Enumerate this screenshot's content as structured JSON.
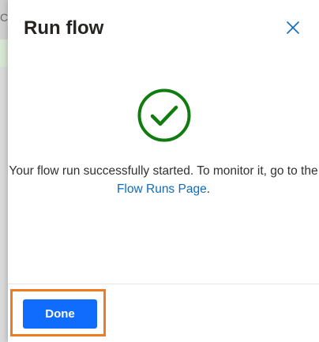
{
  "backdrop": {
    "partial_char": "C"
  },
  "panel": {
    "title": "Run flow",
    "close_icon": "close-icon",
    "status_icon": "check-circle-icon",
    "message_before": "Your flow run successfully started. To monitor it, go to the ",
    "link_text": "Flow Runs Page",
    "message_after": ".",
    "done_label": "Done"
  },
  "colors": {
    "success": "#107c10",
    "primary_button": "#0f6cfc",
    "link": "#0f6cbd",
    "highlight": "#ee7d22"
  }
}
